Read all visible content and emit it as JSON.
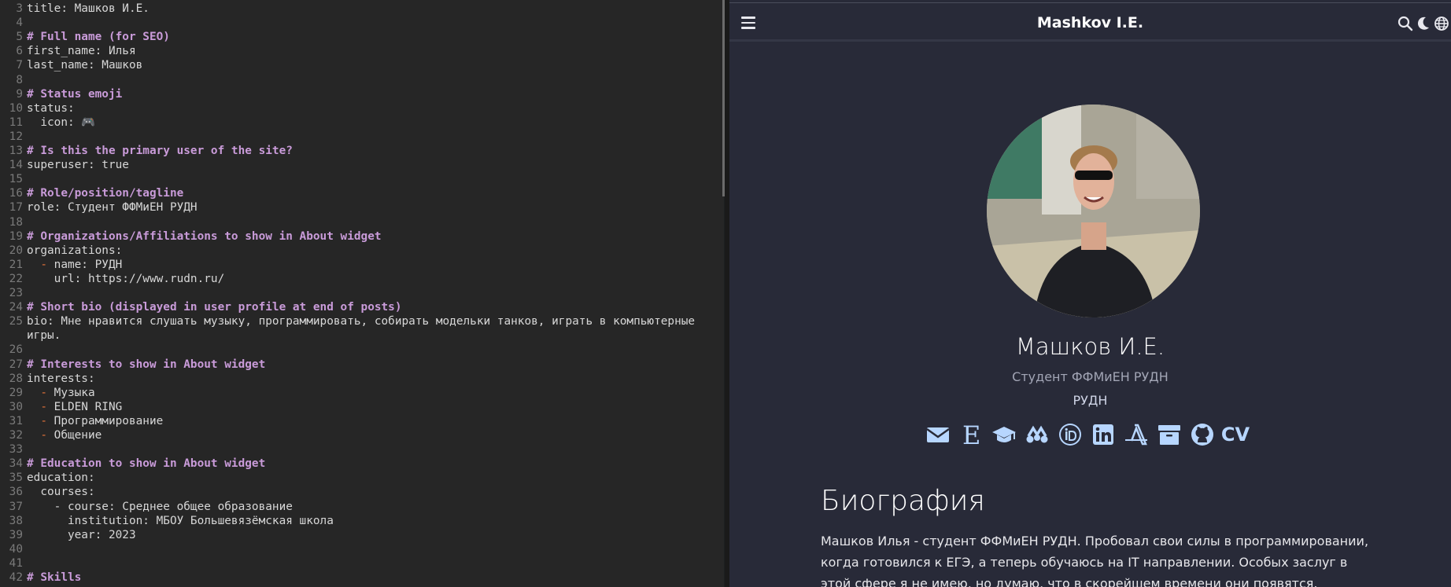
{
  "editor": {
    "lines": [
      {
        "n": "3",
        "text": "title: Машков И.Е.",
        "kind": "plain",
        "indent": ""
      },
      {
        "n": "4",
        "text": "",
        "kind": "plain",
        "indent": ""
      },
      {
        "n": "5",
        "text": "# Full name (for SEO)",
        "kind": "comment",
        "indent": ""
      },
      {
        "n": "6",
        "text": "first_name: Илья",
        "kind": "plain",
        "indent": ""
      },
      {
        "n": "7",
        "text": "last_name: Машков",
        "kind": "plain",
        "indent": ""
      },
      {
        "n": "8",
        "text": "",
        "kind": "plain",
        "indent": ""
      },
      {
        "n": "9",
        "text": "# Status emoji",
        "kind": "comment",
        "indent": ""
      },
      {
        "n": "10",
        "text": "status:",
        "kind": "plain",
        "indent": ""
      },
      {
        "n": "11",
        "text": "  icon: 🎮",
        "kind": "plain",
        "indent": ""
      },
      {
        "n": "12",
        "text": "",
        "kind": "plain",
        "indent": ""
      },
      {
        "n": "13",
        "text": "# Is this the primary user of the site?",
        "kind": "comment",
        "indent": ""
      },
      {
        "n": "14",
        "text": "superuser: true",
        "kind": "plain",
        "indent": ""
      },
      {
        "n": "15",
        "text": "",
        "kind": "plain",
        "indent": ""
      },
      {
        "n": "16",
        "text": "# Role/position/tagline",
        "kind": "comment",
        "indent": ""
      },
      {
        "n": "17",
        "text": "role: Студент ФФМиЕН РУДН",
        "kind": "plain",
        "indent": ""
      },
      {
        "n": "18",
        "text": "",
        "kind": "plain",
        "indent": ""
      },
      {
        "n": "19",
        "text": "# Organizations/Affiliations to show in About widget",
        "kind": "comment",
        "indent": ""
      },
      {
        "n": "20",
        "text": "organizations:",
        "kind": "plain",
        "indent": ""
      },
      {
        "n": "21",
        "text": "name: РУДН",
        "kind": "dash",
        "indent": "  "
      },
      {
        "n": "22",
        "text": "    url: https://www.rudn.ru/",
        "kind": "plain",
        "indent": ""
      },
      {
        "n": "23",
        "text": "",
        "kind": "plain",
        "indent": ""
      },
      {
        "n": "24",
        "text": "# Short bio (displayed in user profile at end of posts)",
        "kind": "comment",
        "indent": ""
      },
      {
        "n": "25",
        "text": "bio: Мне нравится слушать музыку, программировать, собирать модельки танков, играть в компьютерные",
        "kind": "plain",
        "indent": ""
      },
      {
        "n": "",
        "text": "игры.",
        "kind": "plain",
        "indent": ""
      },
      {
        "n": "26",
        "text": "",
        "kind": "plain",
        "indent": ""
      },
      {
        "n": "27",
        "text": "# Interests to show in About widget",
        "kind": "comment",
        "indent": ""
      },
      {
        "n": "28",
        "text": "interests:",
        "kind": "plain",
        "indent": ""
      },
      {
        "n": "29",
        "text": "Музыка",
        "kind": "dash",
        "indent": "  "
      },
      {
        "n": "30",
        "text": "ELDEN RING",
        "kind": "dash",
        "indent": "  "
      },
      {
        "n": "31",
        "text": "Программирование",
        "kind": "dash",
        "indent": "  "
      },
      {
        "n": "32",
        "text": "Общение",
        "kind": "dash",
        "indent": "  "
      },
      {
        "n": "33",
        "text": "",
        "kind": "plain",
        "indent": ""
      },
      {
        "n": "34",
        "text": "# Education to show in About widget",
        "kind": "comment",
        "indent": ""
      },
      {
        "n": "35",
        "text": "education:",
        "kind": "plain",
        "indent": ""
      },
      {
        "n": "36",
        "text": "  courses:",
        "kind": "plain",
        "indent": ""
      },
      {
        "n": "37",
        "text": "    - course: Среднее общее образование",
        "kind": "plain",
        "indent": ""
      },
      {
        "n": "38",
        "text": "      institution: МБОУ Большевязёмская школа",
        "kind": "plain",
        "indent": ""
      },
      {
        "n": "39",
        "text": "      year: 2023",
        "kind": "plain",
        "indent": ""
      },
      {
        "n": "40",
        "text": "",
        "kind": "plain",
        "indent": ""
      },
      {
        "n": "41",
        "text": "",
        "kind": "plain",
        "indent": ""
      },
      {
        "n": "42",
        "text": "# Skills",
        "kind": "comment",
        "indent": ""
      }
    ]
  },
  "preview": {
    "site_title": "Mashkov I.E.",
    "profile": {
      "name": "Машков И.Е.",
      "role": "Студент ФФМиЕН РУДН",
      "organization": "РУДН"
    },
    "social": [
      {
        "icon": "envelope-icon",
        "name": "email"
      },
      {
        "icon": "e-letter-icon",
        "name": "e-library"
      },
      {
        "icon": "graduation-cap-icon",
        "name": "google-scholar"
      },
      {
        "icon": "mendeley-icon",
        "name": "mendeley"
      },
      {
        "icon": "orcid-icon",
        "name": "orcid"
      },
      {
        "icon": "linkedin-icon",
        "name": "linkedin"
      },
      {
        "icon": "a-letter-icon",
        "name": "academia"
      },
      {
        "icon": "archive-icon",
        "name": "archive"
      },
      {
        "icon": "github-icon",
        "name": "github"
      },
      {
        "icon": "cv-icon",
        "name": "cv",
        "text": "CV"
      }
    ],
    "bio": {
      "heading": "Биография",
      "text": "Машков Илья - студент ФФМиЕН РУДН. Пробовал свои силы в программировании, когда готовился к ЕГЭ, а теперь обучаюсь на IT направлении. Особых заслуг в этой сфере я не имею, но думаю, что в скорейшем времени они появятся."
    }
  },
  "colors": {
    "editor_bg": "#262626",
    "comment": "#c99bd9",
    "dash": "#e5733a",
    "preview_bg": "#282a38",
    "icon_blue": "#b7d6ff"
  }
}
